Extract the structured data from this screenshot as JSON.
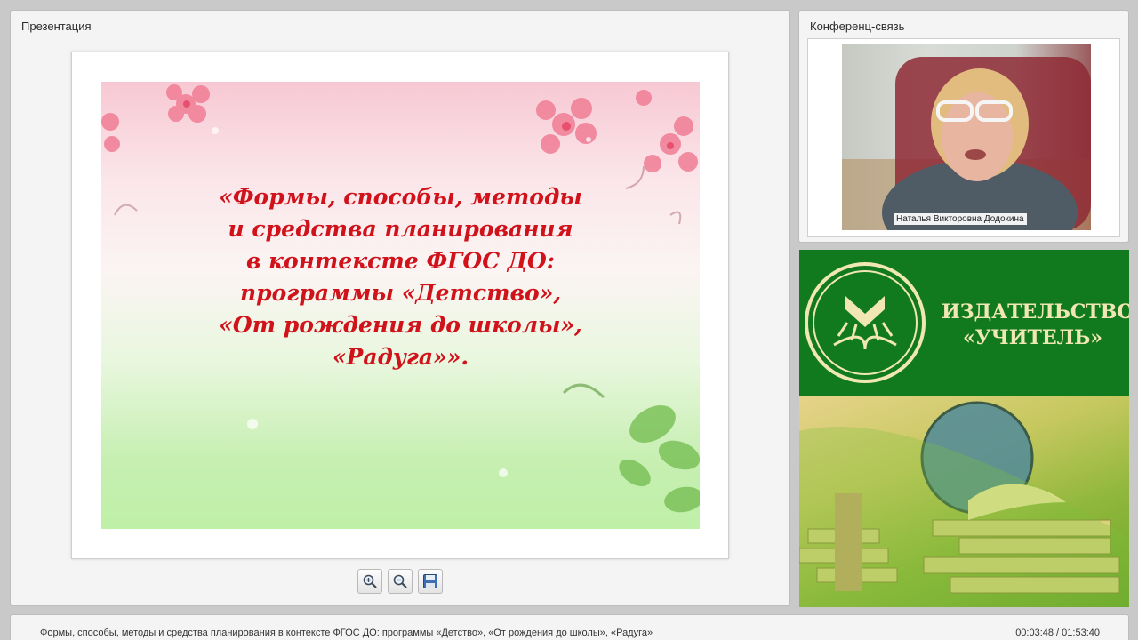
{
  "presentation": {
    "title": "Презентация",
    "slide_title": "«Формы, способы, методы\nи средства планирования\nв контексте ФГОС ДО:\nпрограммы «Детство»,\n«От рождения до школы»,\n«Радуга»».",
    "toolbar": [
      {
        "name": "zoom-in-button",
        "icon": "zoom-in-icon"
      },
      {
        "name": "zoom-out-button",
        "icon": "zoom-out-icon"
      },
      {
        "name": "save-button",
        "icon": "floppy-disk-icon"
      }
    ]
  },
  "conference": {
    "title": "Конференц-связь",
    "speaker_name": "Наталья Викторовна Додокина"
  },
  "ad": {
    "line1": "ИЗДАТЕЛЬСТВО",
    "line2": "«УЧИТЕЛЬ»"
  },
  "bottom": {
    "title": "Формы, способы, методы и средства планирования в контексте ФГОС ДО: программы «Детство», «От рождения до школы», «Радуга»",
    "time": "00:03:48 / 01:53:40"
  },
  "colors": {
    "slide_title": "#d0121b",
    "ad_green": "#127a1e",
    "ad_text": "#f0e7b5"
  }
}
